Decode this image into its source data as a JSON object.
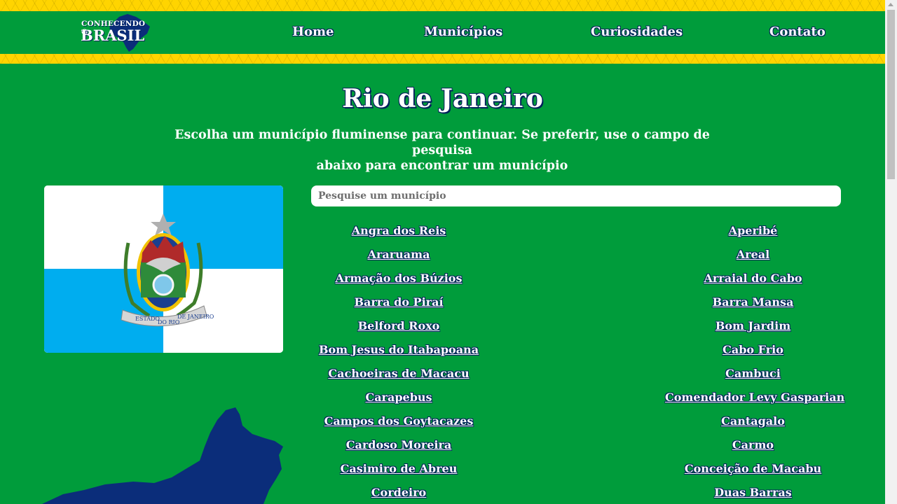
{
  "header": {
    "logo_small": "CONHECENDO O",
    "logo_big": "BRASIL",
    "nav": [
      {
        "label": "Home"
      },
      {
        "label": "Municípios"
      },
      {
        "label": "Curiosidades"
      },
      {
        "label": "Contato"
      }
    ]
  },
  "main": {
    "title": "Rio de Janeiro",
    "subtitle_line1": "Escolha um município fluminense para continuar. Se preferir, use o campo de pesquisa",
    "subtitle_line2": "abaixo para encontrar um município",
    "search_placeholder": "Pesquise um município",
    "flag_text_left": "ESTADO",
    "flag_text_mid": "DO RIO",
    "flag_text_right": "DE JANEIRO",
    "municipalities_left": [
      "Angra dos Reis",
      "Araruama",
      "Armação dos Búzios",
      "Barra do Piraí",
      "Belford Roxo",
      "Bom Jesus do Itabapoana",
      "Cachoeiras de Macacu",
      "Carapebus",
      "Campos dos Goytacazes",
      "Cardoso Moreira",
      "Casimiro de Abreu",
      "Cordeiro"
    ],
    "municipalities_right": [
      "Aperibé",
      "Areal",
      "Arraial do Cabo",
      "Barra Mansa",
      "Bom Jardim",
      "Cabo Frio",
      "Cambuci",
      "Comendador Levy Gasparian",
      "Cantagalo",
      "Carmo",
      "Conceição de Macabu",
      "Duas Barras"
    ]
  },
  "colors": {
    "background": "#009c3b",
    "stripe": "#ffd400",
    "navy": "#00205b",
    "flag_blue": "#00adef"
  }
}
